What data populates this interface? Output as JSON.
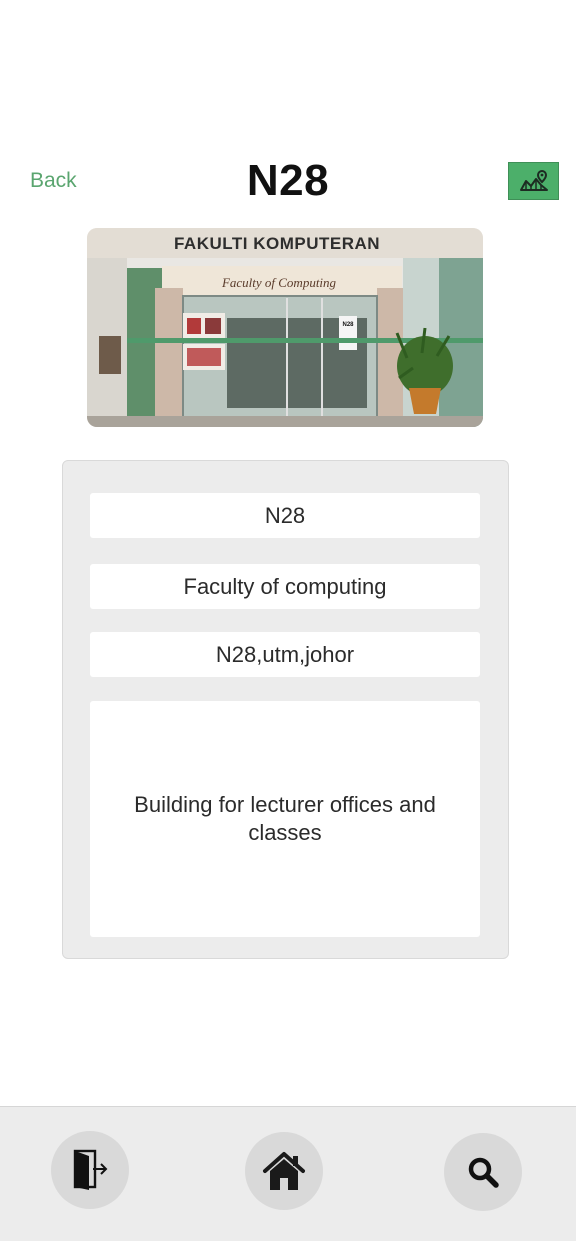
{
  "header": {
    "back_label": "Back",
    "title": "N28",
    "map_icon": "map-pin-icon"
  },
  "photo": {
    "sign_text": "FAKULTI KOMPUTERAN",
    "sub_sign_text": "Faculty of Computing",
    "poster_text": "N28"
  },
  "details": {
    "code": "N28",
    "name": "Faculty of computing",
    "address": "N28,utm,johor",
    "description": "Building for lecturer offices and classes"
  },
  "nav": {
    "exit_icon": "exit-door-icon",
    "home_icon": "home-icon",
    "search_icon": "search-icon"
  },
  "colors": {
    "accent": "#4caf6a",
    "back_link": "#5aa56f"
  }
}
